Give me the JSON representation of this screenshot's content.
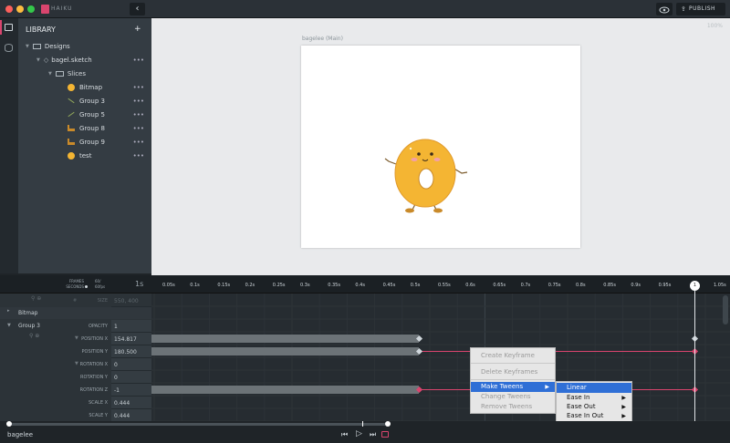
{
  "titlebar": {
    "app_name": "HAIKU",
    "back_icon": "chevron-left-icon",
    "eye_icon": "eye-icon",
    "publish_label": "PUBLISH",
    "traffic_colors": [
      "#fc605c",
      "#fdbc40",
      "#34c84a"
    ]
  },
  "library": {
    "title": "LIBRARY",
    "add_label": "+",
    "items": [
      {
        "label": "Designs",
        "icon": "folder-icon"
      },
      {
        "label": "bagel.sketch",
        "icon": "sketch-icon",
        "menu": "•••"
      },
      {
        "label": "Slices",
        "icon": "folder-icon"
      },
      {
        "label": "Bitmap",
        "icon": "bitmap-icon",
        "menu": "•••"
      },
      {
        "label": "Group 3",
        "icon": "line-icon",
        "menu": "•••"
      },
      {
        "label": "Group 5",
        "icon": "line-icon",
        "menu": "•••"
      },
      {
        "label": "Group 8",
        "icon": "foot-icon",
        "menu": "•••"
      },
      {
        "label": "Group 9",
        "icon": "foot-icon",
        "menu": "•••"
      },
      {
        "label": "test",
        "icon": "bitmap-icon",
        "menu": "•••"
      }
    ]
  },
  "stage": {
    "artboard_label": "bagelee (Main)",
    "zoom": "100%"
  },
  "timeline": {
    "frames_label": "FRAMES",
    "seconds_label": "SECONDS",
    "fps_label": "60/",
    "fps_unit": "60fps",
    "zoom_label": "1s",
    "ticks": [
      "0.05s",
      "0.1s",
      "0.15s",
      "0.2s",
      "0.25s",
      "0.3s",
      "0.35s",
      "0.4s",
      "0.45s",
      "0.5s",
      "0.55s",
      "0.6s",
      "0.65s",
      "0.7s",
      "0.75s",
      "0.8s",
      "0.85s",
      "0.9s",
      "0.95s",
      "1",
      "1.05s"
    ],
    "size_label": "SIZE",
    "size_value": "550, 400",
    "bitmap_label": "Bitmap",
    "group_label": "Group 3",
    "properties": [
      {
        "label": "OPACITY",
        "value": "1"
      },
      {
        "label": "POSITION X",
        "value": "154.817"
      },
      {
        "label": "POSITION Y",
        "value": "180.500"
      },
      {
        "label": "ROTATION X",
        "value": "0"
      },
      {
        "label": "ROTATION Y",
        "value": "0"
      },
      {
        "label": "ROTATION Z",
        "value": "-1"
      },
      {
        "label": "SCALE X",
        "value": "0.444"
      },
      {
        "label": "SCALE Y",
        "value": "0.444"
      }
    ]
  },
  "context_menu": {
    "items": [
      "Create Keyframe",
      "Delete Keyframes",
      "Make Tweens",
      "Change Tweens",
      "Remove Tweens"
    ],
    "submenu": [
      "Linear",
      "Ease In",
      "Ease Out",
      "Ease In Out"
    ],
    "arrow": "▶"
  },
  "bottom": {
    "component_name": "bagelee"
  },
  "colors": {
    "accent": "#d9456e",
    "selection": "#2f6fd6",
    "bagel": "#f4b533"
  }
}
